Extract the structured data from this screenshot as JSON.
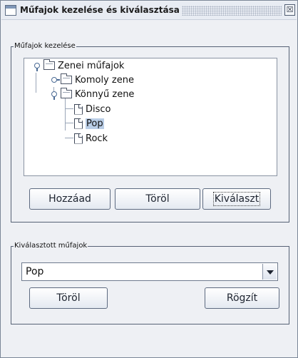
{
  "window": {
    "title": "Műfajok kezelése és kiválasztása",
    "close_glyph": "☒"
  },
  "manage_group": {
    "label": "Műfajok kezelése",
    "tree": {
      "root": "Zenei műfajok",
      "children": [
        {
          "label": "Komoly zene",
          "expanded": false
        },
        {
          "label": "Könnyű zene",
          "expanded": true,
          "children": [
            "Disco",
            "Pop",
            "Rock"
          ]
        }
      ],
      "selected": "Pop"
    },
    "buttons": {
      "add": "Hozzáad",
      "delete": "Töröl",
      "select": "Kiválaszt"
    }
  },
  "selected_group": {
    "label": "Kiválasztott műfajok",
    "combo_value": "Pop",
    "buttons": {
      "delete": "Töröl",
      "save": "Rögzít"
    }
  }
}
